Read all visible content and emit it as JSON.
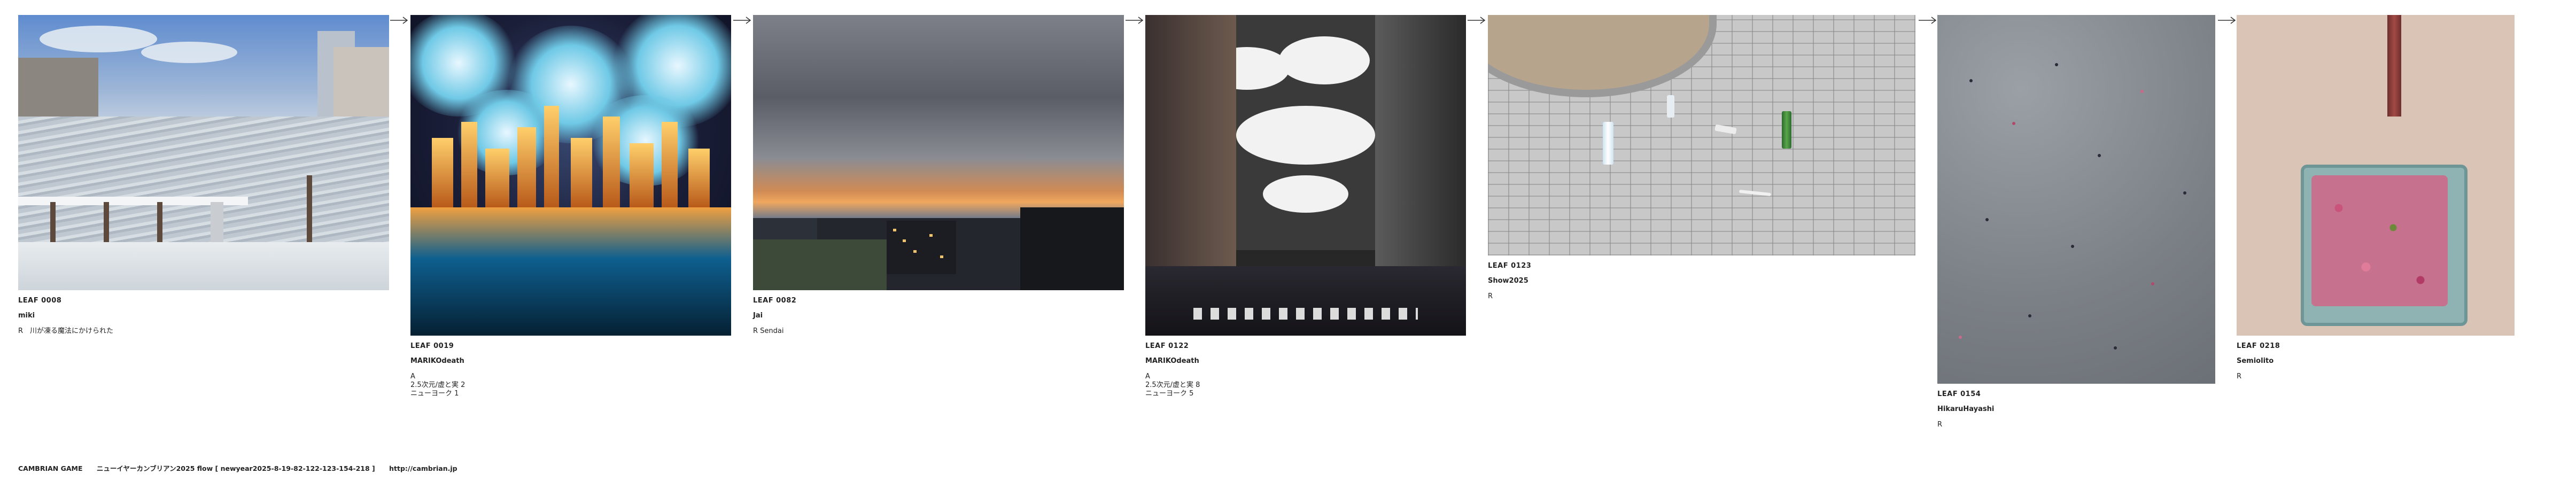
{
  "entries": [
    {
      "id": "LEAF 0008",
      "author": "miki",
      "comment": "R　川が凍る魔法にかけられた"
    },
    {
      "id": "LEAF 0019",
      "author": "MARIKOdeath",
      "comment": "A\n2.5次元/虚と実 2\nニューヨーク 1"
    },
    {
      "id": "LEAF 0082",
      "author": "Jai",
      "comment": "R Sendai"
    },
    {
      "id": "LEAF 0122",
      "author": "MARIKOdeath",
      "comment": "A\n2.5次元/虚と実 8\nニューヨーク 5"
    },
    {
      "id": "LEAF 0123",
      "author": "Show2025",
      "comment": "R"
    },
    {
      "id": "LEAF 0154",
      "author": "HikaruHayashi",
      "comment": "R"
    },
    {
      "id": "LEAF 0218",
      "author": "Semiolito",
      "comment": "R"
    }
  ],
  "footer": {
    "brand": "CAMBRIAN GAME",
    "flow": "ニューイヤーカンブリアン2025  flow [ newyear2025-8-19-82-122-123-154-218 ]",
    "url": "http://cambrian.jp"
  },
  "icons": {
    "connector": "right-arrow-icon"
  },
  "colors": {
    "text": "#222222",
    "background": "#ffffff"
  }
}
